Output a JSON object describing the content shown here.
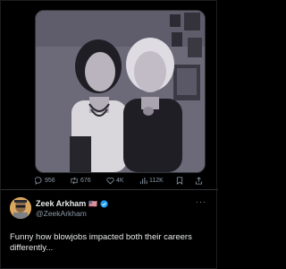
{
  "post": {
    "metrics": {
      "replies": "956",
      "reposts": "676",
      "likes": "4K",
      "views": "112K"
    }
  },
  "quote": {
    "author_name": "Zeek Arkham",
    "author_flag": "🇺🇸",
    "author_handle": "@ZeekArkham",
    "text": "Funny how blowjobs impacted both their careers differently...",
    "more_label": "···",
    "colors": {
      "verified": "#1d9bf0",
      "muted": "#8b98a5",
      "text": "#e7e9ea"
    }
  },
  "icons": [
    "reply-icon",
    "repost-icon",
    "like-icon",
    "views-icon",
    "bookmark-icon",
    "share-icon",
    "verified-badge-icon",
    "more-options-icon"
  ]
}
